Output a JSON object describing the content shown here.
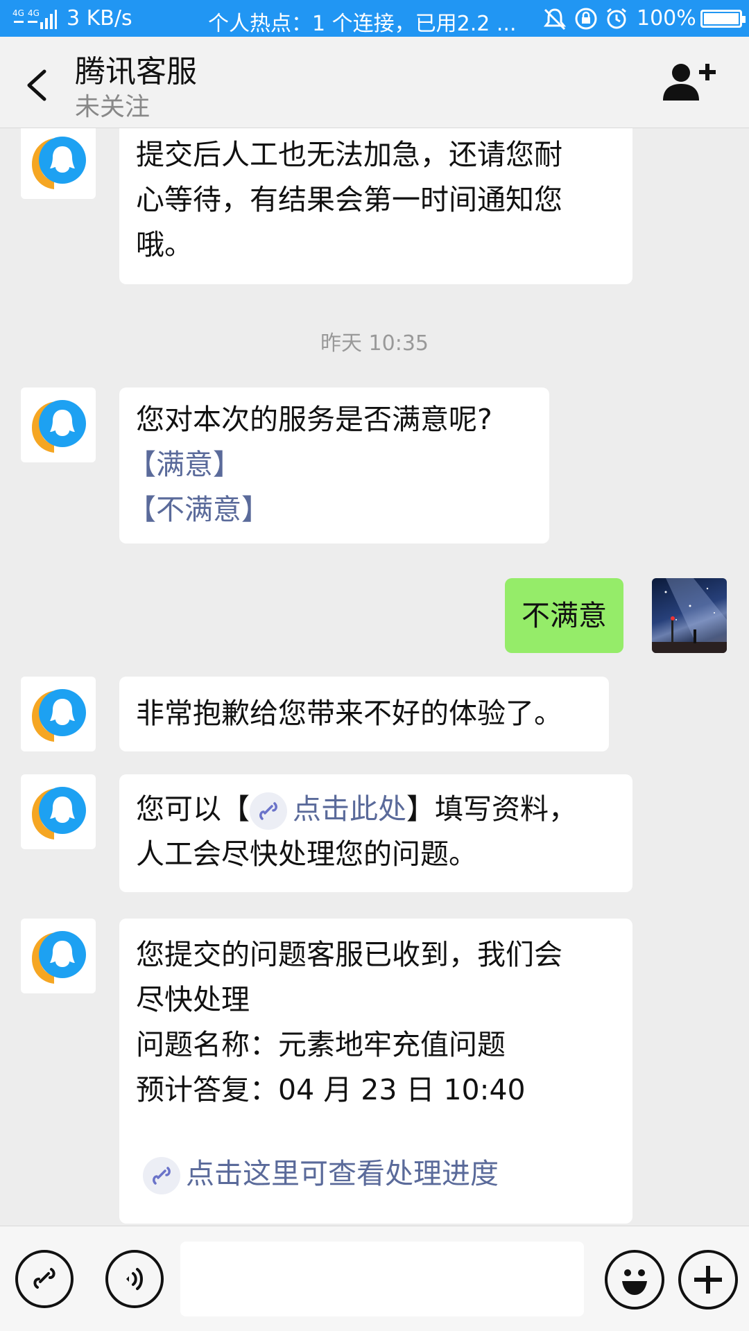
{
  "status_bar": {
    "network": "4G 4G",
    "speed": "3 KB/s",
    "hotspot": "个人热点：1 个连接，已用2.2 ...",
    "battery": "100%",
    "icons": [
      "do-not-disturb-icon",
      "lock-rotation-icon",
      "alarm-icon",
      "battery-icon"
    ]
  },
  "header": {
    "title": "腾讯客服",
    "subtitle": "未关注",
    "back_icon": "chevron-left-icon",
    "add_icon": "add-friend-icon"
  },
  "messages": {
    "m1": {
      "line1": "提交后人工也无法加急，还请您耐",
      "line2": "心等待，有结果会第一时间通知您",
      "line3": "哦。"
    },
    "timestamp": "昨天 10:35",
    "m2": {
      "question": "您对本次的服务是否满意呢?",
      "option1": "【满意】",
      "option2": "【不满意】"
    },
    "m3": {
      "text": "不满意"
    },
    "m4": {
      "text": "非常抱歉给您带来不好的体验了。"
    },
    "m5": {
      "prefix": "您可以【",
      "link": "点击此处",
      "suffix": "】填写资料，",
      "line2": "人工会尽快处理您的问题。"
    },
    "m6": {
      "line1": "您提交的问题客服已收到，我们会",
      "line2": "尽快处理",
      "line3": "问题名称：元素地牢充值问题",
      "line4": "预计答复：04 月 23 日 10:40",
      "link": "点击这里可查看处理进度"
    }
  },
  "input_bar": {
    "placeholder": "",
    "icons": [
      "mini-program-icon",
      "voice-icon",
      "emoji-icon",
      "plus-icon"
    ]
  },
  "colors": {
    "status_bar": "#2196f3",
    "my_bubble": "#95ec69",
    "link": "#5a6a9a",
    "qq_blue": "#1da1f2",
    "qq_orange": "#f5a623"
  }
}
